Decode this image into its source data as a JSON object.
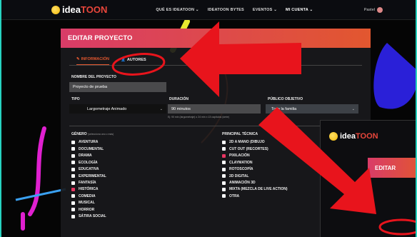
{
  "topnav": {
    "logo_a": "idea",
    "logo_b": "TOON",
    "items": [
      "QUÉ ES IDEATOON ⌄",
      "IDEATOON BYTES",
      "EVENTOS ⌄",
      "MI CUENTA ⌄"
    ],
    "user": "Pastel"
  },
  "panel": {
    "title": "EDITAR PROYECTO",
    "tabs": [
      "INFORMACIÓN",
      "AUTORES"
    ],
    "name_label": "NOMBRE DEL PROYECTO",
    "name_value": "Proyecto de prueba",
    "tipo_label": "TIPO",
    "tipo_value": "Largometraje Animado",
    "duracion_label": "DURACIÓN",
    "duracion_value": "90 minutos",
    "duracion_hint": "Ej: 90 min (largometraje) o 24 min x 13 capítulos (serie)",
    "publico_label": "PÚBLICO OBJETIVO",
    "publico_value": "Toda la familia",
    "genero_label": "GÉNERO",
    "genero_hint": "(selecciona uno o más)",
    "generos": [
      {
        "label": "AVENTURA",
        "checked": false
      },
      {
        "label": "DOCUMENTAL",
        "checked": false
      },
      {
        "label": "DRAMA",
        "checked": false
      },
      {
        "label": "ECOLOGÍA",
        "checked": false
      },
      {
        "label": "EDUCATIVA",
        "checked": false
      },
      {
        "label": "EXPERIMENTAL",
        "checked": false
      },
      {
        "label": "FANTASÍA",
        "checked": false
      },
      {
        "label": "HISTÓRICA",
        "checked": true
      },
      {
        "label": "COMEDIA",
        "checked": false
      },
      {
        "label": "MUSICAL",
        "checked": false
      },
      {
        "label": "HORROR",
        "checked": false
      },
      {
        "label": "SÁTIRA SOCIAL",
        "checked": false
      }
    ],
    "tecnica_label": "PRINCIPAL TÉCNICA",
    "tecnicas": [
      {
        "label": "2D A MANO (DIBUJO",
        "checked": false
      },
      {
        "label": "CUT OUT (RECORTES)",
        "checked": false
      },
      {
        "label": "PIXILACIÓN",
        "checked": true
      },
      {
        "label": "CLAYMATION",
        "checked": false
      },
      {
        "label": "ROTOSCOPÍA",
        "checked": false
      },
      {
        "label": "2D DIGITAL",
        "checked": false
      },
      {
        "label": "ANIMACIÓN 3D",
        "checked": false
      },
      {
        "label": "MIXTA (MEZCLA DE LIVE ACTION)",
        "checked": false
      },
      {
        "label": "OTRA",
        "checked": false
      }
    ]
  },
  "inset": {
    "logo_a": "idea",
    "logo_b": "TOON",
    "title": "EDITAR"
  },
  "colors": {
    "accent": "#e2572f",
    "arrow": "#e8141c",
    "check": "#e83562"
  }
}
